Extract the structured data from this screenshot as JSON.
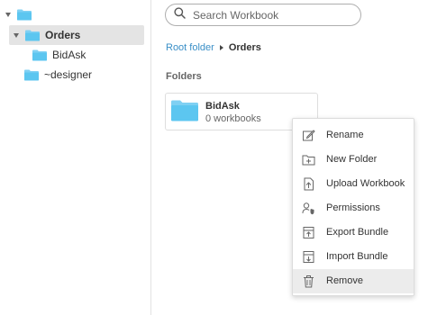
{
  "sidebar": {
    "root": {
      "label": "",
      "icon": "folder-icon"
    },
    "items": [
      {
        "label": "Orders",
        "selected": true,
        "expanded": true,
        "icon": "folder-icon"
      },
      {
        "label": "BidAsk",
        "selected": false,
        "icon": "folder-icon"
      },
      {
        "label": "~designer",
        "selected": false,
        "icon": "folder-icon"
      }
    ]
  },
  "search": {
    "placeholder": "Search Workbook",
    "value": ""
  },
  "breadcrumb": {
    "root": "Root folder",
    "current": "Orders"
  },
  "section": {
    "title": "Folders"
  },
  "folders": [
    {
      "name": "BidAsk",
      "count": "0 workbooks"
    }
  ],
  "context_menu": {
    "items": [
      {
        "label": "Rename",
        "icon": "rename-icon"
      },
      {
        "label": "New Folder",
        "icon": "new-folder-icon"
      },
      {
        "label": "Upload Workbook",
        "icon": "upload-icon"
      },
      {
        "label": "Permissions",
        "icon": "permissions-icon"
      },
      {
        "label": "Export Bundle",
        "icon": "export-icon"
      },
      {
        "label": "Import Bundle",
        "icon": "import-icon"
      },
      {
        "label": "Remove",
        "icon": "trash-icon",
        "highlighted": true
      }
    ]
  },
  "colors": {
    "folder": "#7fd0f3",
    "folder_dark": "#5cbde8",
    "link": "#3a8fc7",
    "selected_bg": "#e4e4e4"
  }
}
